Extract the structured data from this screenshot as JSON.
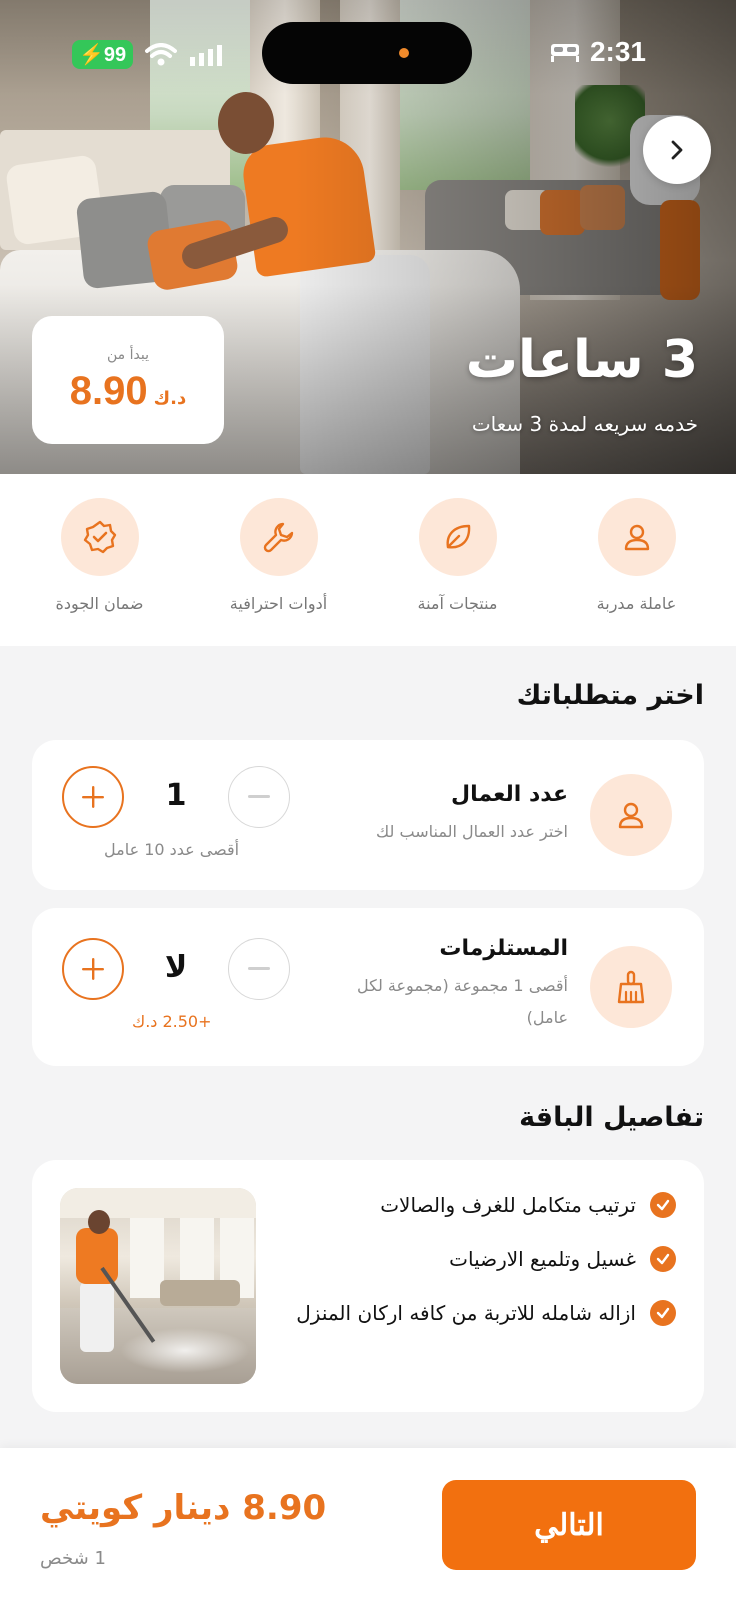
{
  "status_bar": {
    "battery": "99",
    "time": "2:31"
  },
  "hero": {
    "title": "3 ساعات",
    "subtitle": "خدمه سريعه لمدة 3 سعات",
    "price_card": {
      "starts_from": "يبدأ من",
      "amount": "8.90",
      "currency": "د.ك"
    }
  },
  "features": [
    {
      "label": "عاملة مدربة",
      "icon": "person-icon"
    },
    {
      "label": "منتجات آمنة",
      "icon": "leaf-icon"
    },
    {
      "label": "أدوات احترافية",
      "icon": "wrench-icon"
    },
    {
      "label": "ضمان الجودة",
      "icon": "badge-check-icon"
    }
  ],
  "requirements": {
    "title": "اختر متطلباتك",
    "workers": {
      "title": "عدد العمال",
      "description": "اختر عدد العمال المناسب لك",
      "value": "1",
      "note": "أقصى عدد 10 عامل"
    },
    "supplies": {
      "title": "المستلزمات",
      "description_line1": "أقصى 1 مجموعة (مجموعة لكل",
      "description_line2": "عامل)",
      "value": "لا",
      "note": "+2.50 د.ك"
    }
  },
  "package": {
    "title": "تفاصيل الباقة",
    "items": [
      "ترتيب متكامل للغرف والصالات",
      "غسيل وتلميع الارضيات",
      "ازاله شامله للاتربة من كافه اركان المنزل"
    ]
  },
  "footer": {
    "total": "8.90 دينار كويتي",
    "persons": "1 شخص",
    "next_label": "التالي"
  },
  "colors": {
    "accent": "#e8731f",
    "accent_soft": "#fde7d8",
    "background": "#f4f4f5"
  }
}
